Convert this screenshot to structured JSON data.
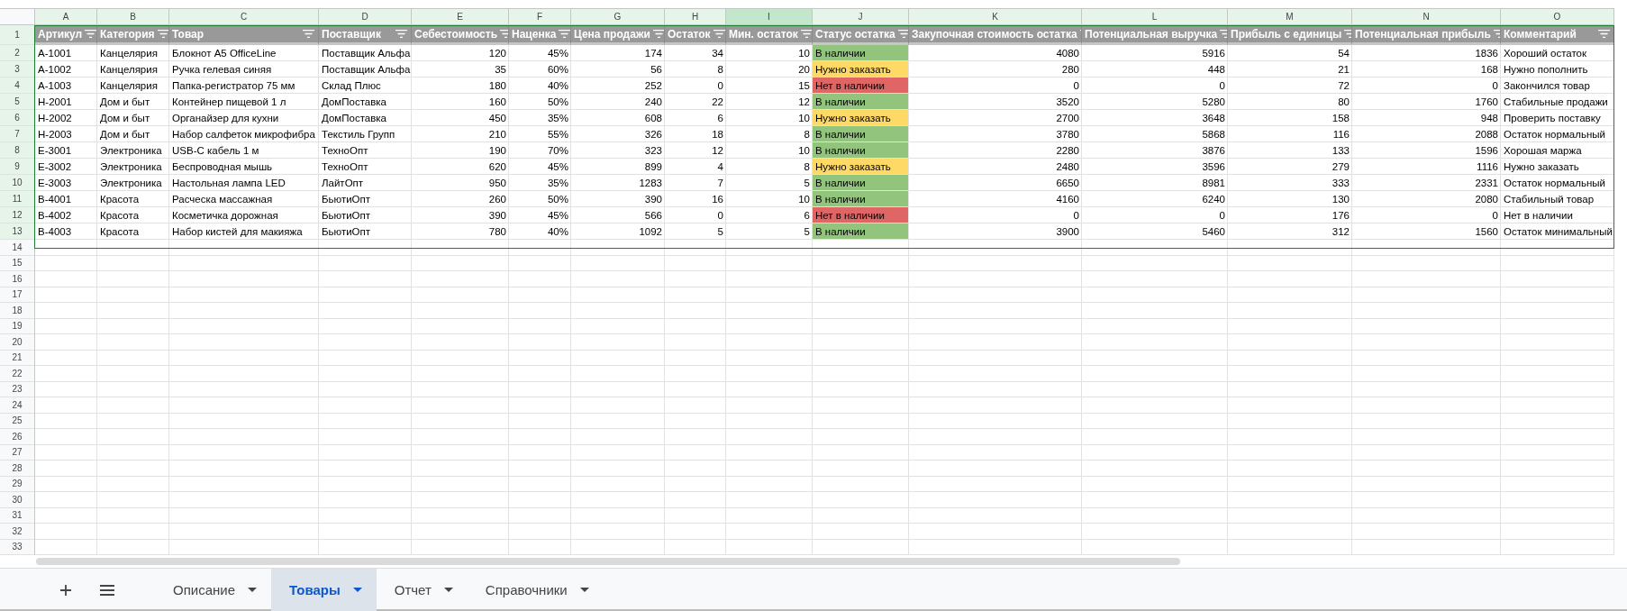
{
  "columns": [
    {
      "letter": "A",
      "kind": "text",
      "selected": false
    },
    {
      "letter": "B",
      "kind": "text",
      "selected": false
    },
    {
      "letter": "C",
      "kind": "text",
      "selected": false
    },
    {
      "letter": "D",
      "kind": "text",
      "selected": false
    },
    {
      "letter": "E",
      "kind": "number",
      "selected": false
    },
    {
      "letter": "F",
      "kind": "number",
      "selected": false
    },
    {
      "letter": "G",
      "kind": "number",
      "selected": false
    },
    {
      "letter": "H",
      "kind": "number",
      "selected": false
    },
    {
      "letter": "I",
      "kind": "number",
      "selected": true
    },
    {
      "letter": "J",
      "kind": "status",
      "selected": false
    },
    {
      "letter": "K",
      "kind": "number",
      "selected": false
    },
    {
      "letter": "L",
      "kind": "number",
      "selected": false
    },
    {
      "letter": "M",
      "kind": "number",
      "selected": false
    },
    {
      "letter": "N",
      "kind": "number",
      "selected": false
    },
    {
      "letter": "O",
      "kind": "text",
      "selected": false
    }
  ],
  "header_row": {
    "number": "1",
    "cells": [
      "Артикул",
      "Категория",
      "Товар",
      "Поставщик",
      "Себестоимость",
      "Наценка",
      "Цена продажи",
      "Остаток",
      "Мин. остаток",
      "Статус остатка",
      "Закупочная стоимость остатка",
      "Потенциальная выручка",
      "Прибыль с единицы",
      "Потенциальная прибыль",
      "Комментарий"
    ]
  },
  "rows": [
    {
      "number": "2",
      "color": "#93c47d",
      "cells": [
        "A-1001",
        "Канцелярия",
        "Блокнот A5 OfficeLine",
        "Поставщик Альфа",
        "120",
        "45%",
        "174",
        "34",
        "10",
        "В наличии",
        "4080",
        "5916",
        "54",
        "1836",
        "Хороший остаток"
      ]
    },
    {
      "number": "3",
      "color": "#ffd966",
      "cells": [
        "A-1002",
        "Канцелярия",
        "Ручка гелевая синяя",
        "Поставщик Альфа",
        "35",
        "60%",
        "56",
        "8",
        "20",
        "Нужно заказать",
        "280",
        "448",
        "21",
        "168",
        "Нужно пополнить"
      ]
    },
    {
      "number": "4",
      "color": "#e06666",
      "cells": [
        "A-1003",
        "Канцелярия",
        "Папка-регистратор 75 мм",
        "Склад Плюс",
        "180",
        "40%",
        "252",
        "0",
        "15",
        "Нет в наличии",
        "0",
        "0",
        "72",
        "0",
        "Закончился товар"
      ]
    },
    {
      "number": "5",
      "color": "#93c47d",
      "cells": [
        "H-2001",
        "Дом и быт",
        "Контейнер пищевой 1 л",
        "ДомПоставка",
        "160",
        "50%",
        "240",
        "22",
        "12",
        "В наличии",
        "3520",
        "5280",
        "80",
        "1760",
        "Стабильные продажи"
      ]
    },
    {
      "number": "6",
      "color": "#ffd966",
      "cells": [
        "H-2002",
        "Дом и быт",
        "Органайзер для кухни",
        "ДомПоставка",
        "450",
        "35%",
        "608",
        "6",
        "10",
        "Нужно заказать",
        "2700",
        "3648",
        "158",
        "948",
        "Проверить поставку"
      ]
    },
    {
      "number": "7",
      "color": "#93c47d",
      "cells": [
        "H-2003",
        "Дом и быт",
        "Набор салфеток микрофибра",
        "Текстиль Групп",
        "210",
        "55%",
        "326",
        "18",
        "8",
        "В наличии",
        "3780",
        "5868",
        "116",
        "2088",
        "Остаток нормальный"
      ]
    },
    {
      "number": "8",
      "color": "#93c47d",
      "cells": [
        "E-3001",
        "Электроника",
        "USB-C кабель 1 м",
        "ТехноОпт",
        "190",
        "70%",
        "323",
        "12",
        "10",
        "В наличии",
        "2280",
        "3876",
        "133",
        "1596",
        "Хорошая маржа"
      ]
    },
    {
      "number": "9",
      "color": "#ffd966",
      "cells": [
        "E-3002",
        "Электроника",
        "Беспроводная мышь",
        "ТехноОпт",
        "620",
        "45%",
        "899",
        "4",
        "8",
        "Нужно заказать",
        "2480",
        "3596",
        "279",
        "1116",
        "Нужно заказать"
      ]
    },
    {
      "number": "10",
      "color": "#93c47d",
      "cells": [
        "E-3003",
        "Электроника",
        "Настольная лампа LED",
        "ЛайтОпт",
        "950",
        "35%",
        "1283",
        "7",
        "5",
        "В наличии",
        "6650",
        "8981",
        "333",
        "2331",
        "Остаток нормальный"
      ]
    },
    {
      "number": "11",
      "color": "#93c47d",
      "cells": [
        "B-4001",
        "Красота",
        "Расческа массажная",
        "БьютиОпт",
        "260",
        "50%",
        "390",
        "16",
        "10",
        "В наличии",
        "4160",
        "6240",
        "130",
        "2080",
        "Стабильный товар"
      ]
    },
    {
      "number": "12",
      "color": "#e06666",
      "cells": [
        "B-4002",
        "Красота",
        "Косметичка дорожная",
        "БьютиОпт",
        "390",
        "45%",
        "566",
        "0",
        "6",
        "Нет в наличии",
        "0",
        "0",
        "176",
        "0",
        "Нет в наличии"
      ]
    },
    {
      "number": "13",
      "color": "#93c47d",
      "cells": [
        "B-4003",
        "Красота",
        "Набор кистей для макияжа",
        "БьютиОпт",
        "780",
        "40%",
        "1092",
        "5",
        "5",
        "В наличии",
        "3900",
        "5460",
        "312",
        "1560",
        "Остаток минимальный"
      ]
    }
  ],
  "empty_row_numbers": [
    "14",
    "15",
    "16",
    "17",
    "18",
    "19",
    "20",
    "21",
    "22",
    "23",
    "24",
    "25",
    "26",
    "27",
    "28",
    "29",
    "30",
    "31",
    "32",
    "33"
  ],
  "sheet_tabs": [
    {
      "label": "Описание",
      "selected": false
    },
    {
      "label": "Товары",
      "selected": true
    },
    {
      "label": "Отчет",
      "selected": false
    },
    {
      "label": "Справочники",
      "selected": false
    }
  ]
}
